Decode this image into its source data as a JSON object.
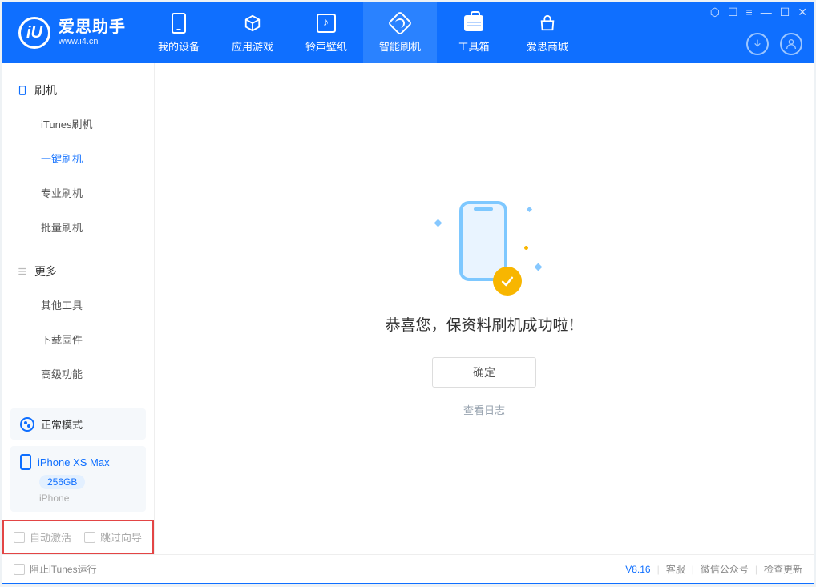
{
  "logo": {
    "title": "爱思助手",
    "subtitle": "www.i4.cn",
    "glyph": "iU"
  },
  "tabs": [
    {
      "label": "我的设备"
    },
    {
      "label": "应用游戏"
    },
    {
      "label": "铃声壁纸"
    },
    {
      "label": "智能刷机"
    },
    {
      "label": "工具箱"
    },
    {
      "label": "爱思商城"
    }
  ],
  "sidebar": {
    "section1": {
      "title": "刷机",
      "items": [
        "iTunes刷机",
        "一键刷机",
        "专业刷机",
        "批量刷机"
      ]
    },
    "section2": {
      "title": "更多",
      "items": [
        "其他工具",
        "下载固件",
        "高级功能"
      ]
    }
  },
  "mode_box": {
    "label": "正常模式"
  },
  "device": {
    "name": "iPhone XS Max",
    "storage": "256GB",
    "type": "iPhone"
  },
  "options": {
    "auto_activate": "自动激活",
    "skip_wizard": "跳过向导"
  },
  "main": {
    "success_text": "恭喜您，保资料刷机成功啦！",
    "confirm": "确定",
    "view_log": "查看日志"
  },
  "footer": {
    "block_itunes": "阻止iTunes运行",
    "version": "V8.16",
    "links": [
      "客服",
      "微信公众号",
      "检查更新"
    ]
  }
}
